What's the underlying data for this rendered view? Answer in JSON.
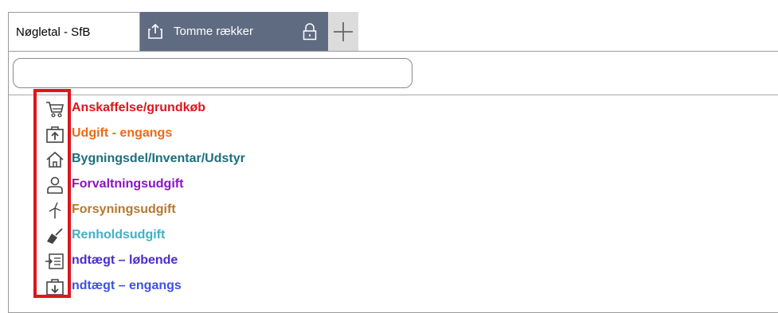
{
  "tabs": {
    "active_label": "Nøgletal - SfB",
    "second_label": "Tomme rækker"
  },
  "search": {
    "value": "",
    "placeholder": ""
  },
  "items": [
    {
      "label": "Anskaffelse/grundkøb",
      "color": "#e0141d",
      "icon": "cart-icon"
    },
    {
      "label": "Udgift - engangs",
      "color": "#ee6a12",
      "icon": "briefcase-up-icon"
    },
    {
      "label": "Bygningsdel/Inventar/Udstyr",
      "color": "#1c6f7c",
      "icon": "house-icon"
    },
    {
      "label": "Forvaltningsudgift",
      "color": "#8b14c4",
      "icon": "person-icon"
    },
    {
      "label": "Forsyningsudgift",
      "color": "#b7782a",
      "icon": "wind-turbine-icon"
    },
    {
      "label": "Renholdsudgift",
      "color": "#43b0c8",
      "icon": "broom-icon"
    },
    {
      "label": "ndtægt – løbende",
      "color": "#4a2bd0",
      "icon": "input-list-icon"
    },
    {
      "label": "ndtægt – engangs",
      "color": "#3d50e8",
      "icon": "briefcase-down-icon"
    }
  ],
  "highlight_color": "#e0141d"
}
